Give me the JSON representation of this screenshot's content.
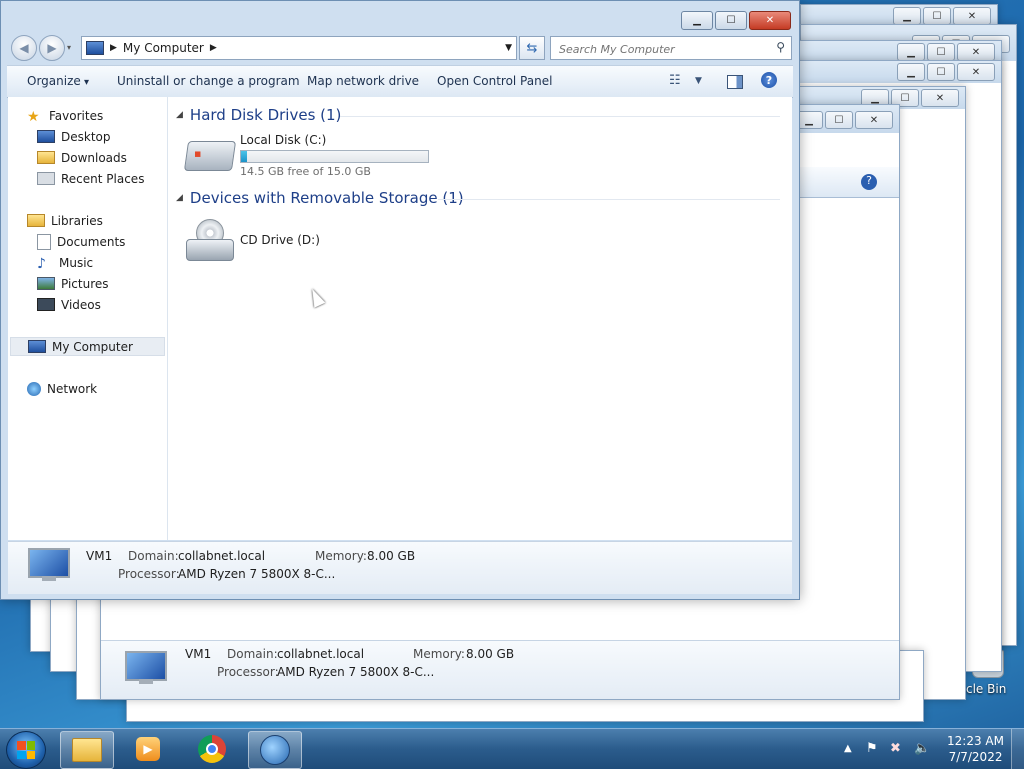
{
  "window": {
    "title": "My Computer",
    "controls": {
      "minimize": "▁",
      "maximize": "☐",
      "close": "✕"
    }
  },
  "nav": {
    "address": "My Computer",
    "search_placeholder": "Search My Computer"
  },
  "toolbar": {
    "organize": "Organize",
    "uninstall": "Uninstall or change a program",
    "map_drive": "Map network drive",
    "control_panel": "Open Control Panel"
  },
  "sidebar": {
    "favorites": "Favorites",
    "desktop": "Desktop",
    "downloads": "Downloads",
    "recent": "Recent Places",
    "libraries": "Libraries",
    "documents": "Documents",
    "music": "Music",
    "pictures": "Pictures",
    "videos": "Videos",
    "computer": "My Computer",
    "network": "Network"
  },
  "content": {
    "hdd_group": "Hard Disk Drives (1)",
    "local_disk": {
      "name": "Local Disk (C:)",
      "free": "14.5 GB free of 15.0 GB",
      "used_fraction": 0.033
    },
    "removable_group": "Devices with Removable Storage (1)",
    "cd_drive": {
      "name": "CD Drive (D:)"
    }
  },
  "details": {
    "name": "VM1",
    "domain_label": "Domain:",
    "domain": "collabnet.local",
    "memory_label": "Memory:",
    "memory": "8.00 GB",
    "processor_label": "Processor:",
    "processor": "AMD Ryzen 7 5800X 8-C..."
  },
  "desktop": {
    "recycle_label": "cle Bin"
  },
  "taskbar": {
    "time": "12:23 AM",
    "date": "7/7/2022"
  }
}
